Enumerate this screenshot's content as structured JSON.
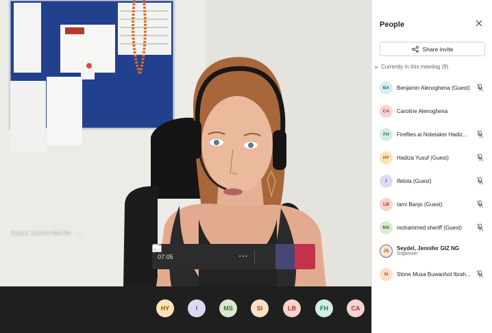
{
  "video": {
    "speaker_name": "Seydel, Jennifer GIZ NG",
    "more_glyph": "···"
  },
  "controls": {
    "timer": "07:05",
    "more_glyph": "···"
  },
  "strip_avatars": [
    {
      "initials": "HY",
      "bg": "#fce4b6",
      "fg": "#8a5a00"
    },
    {
      "initials": "I",
      "bg": "#dcdaf2",
      "fg": "#4f4b9c"
    },
    {
      "initials": "MS",
      "bg": "#dbe9cf",
      "fg": "#3e6b28"
    },
    {
      "initials": "SI",
      "bg": "#fbe0c7",
      "fg": "#9a4d13"
    },
    {
      "initials": "LB",
      "bg": "#f7d3cc",
      "fg": "#a33a26"
    },
    {
      "initials": "FH",
      "bg": "#d3ede1",
      "fg": "#2c7050"
    },
    {
      "initials": "CA",
      "bg": "#f6d3d3",
      "fg": "#a33a3a"
    }
  ],
  "panel": {
    "title": "People",
    "share_label": "Share invite",
    "section_label": "Currently in this meeting (9)",
    "participants": [
      {
        "initials": "BA",
        "name": "Benjamin Alenoghena (Guest)",
        "muted": true,
        "bg": "#d7ecf2",
        "fg": "#2b6a80"
      },
      {
        "initials": "CA",
        "name": "Caroline Alenoghena",
        "muted": false,
        "bg": "#f6d3d3",
        "fg": "#a33a3a"
      },
      {
        "initials": "FH",
        "name": "Fireflies.ai Notetaker Hadiza ...",
        "muted": true,
        "bg": "#d3ede1",
        "fg": "#2c7050"
      },
      {
        "initials": "HY",
        "name": "Hadiza Yusuf (Guest)",
        "muted": true,
        "bg": "#fce4b6",
        "fg": "#8a5a00"
      },
      {
        "initials": "I",
        "name": "Ifetola (Guest)",
        "muted": true,
        "bg": "#dcdaf2",
        "fg": "#4f4b9c"
      },
      {
        "initials": "LB",
        "name": "Iami Banjo (Guest)",
        "muted": true,
        "bg": "#f7d3cc",
        "fg": "#a33a26"
      },
      {
        "initials": "MS",
        "name": "mohammed sheriff (Guest)",
        "muted": true,
        "bg": "#dbe9cf",
        "fg": "#3e6b28"
      },
      {
        "initials": "JS",
        "name": "Seydel, Jennifer GIZ NG",
        "subtitle": "Organizer",
        "muted": false,
        "bg": "#fbe6d0",
        "fg": "#9a4d13"
      },
      {
        "initials": "SI",
        "name": "Stone Musa Buwanhot Ibrah...",
        "muted": true,
        "bg": "#fbe0c7",
        "fg": "#9a4d13"
      }
    ]
  }
}
